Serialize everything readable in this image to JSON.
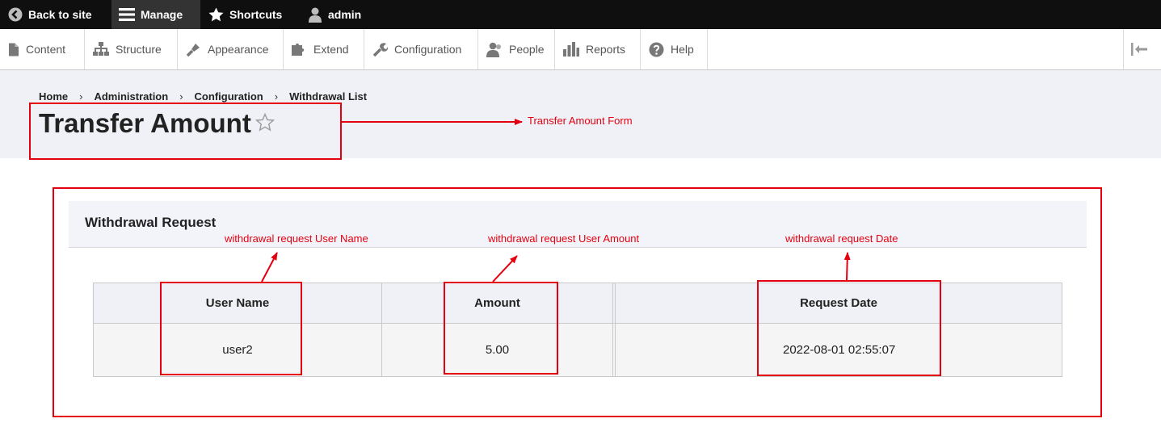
{
  "toolbar": {
    "back_label": "Back to site",
    "manage_label": "Manage",
    "shortcuts_label": "Shortcuts",
    "user_label": "admin"
  },
  "admin_menu": {
    "items": [
      {
        "label": "Content",
        "icon": "file-icon"
      },
      {
        "label": "Structure",
        "icon": "sitemap-icon"
      },
      {
        "label": "Appearance",
        "icon": "paintbrush-icon"
      },
      {
        "label": "Extend",
        "icon": "puzzle-icon"
      },
      {
        "label": "Configuration",
        "icon": "wrench-icon"
      },
      {
        "label": "People",
        "icon": "people-icon"
      },
      {
        "label": "Reports",
        "icon": "bar-chart-icon"
      },
      {
        "label": "Help",
        "icon": "help-icon"
      }
    ]
  },
  "breadcrumb": [
    "Home",
    "Administration",
    "Configuration",
    "Withdrawal List"
  ],
  "page": {
    "title": "Transfer Amount"
  },
  "details": {
    "title": "Withdrawal Request"
  },
  "table": {
    "headers": [
      "User Name",
      "Amount",
      "",
      "Request Date"
    ],
    "rows": [
      [
        "user2",
        "5.00",
        "",
        "2022-08-01 02:55:07"
      ]
    ]
  },
  "annotations": {
    "title_note": "Transfer Amount Form",
    "username_note": "withdrawal request User Name",
    "amount_note": "withdrawal request User Amount",
    "date_note": "withdrawal request Date"
  },
  "colors": {
    "toolbar_bg": "#0f0f0f",
    "header_bg": "#f0f1f7",
    "annotation_red": "#e4000f"
  }
}
